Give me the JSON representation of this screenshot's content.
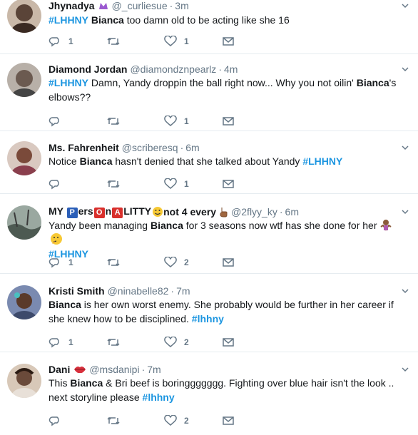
{
  "tweets": [
    {
      "name": "Jhynadya",
      "handle": "@_curliesue",
      "sep": "·",
      "time": "3m",
      "pre_text": "",
      "hashtag_a": "#LHHNY",
      "bold_a": "Bianca",
      "text_a": " too damn old to be acting like she 16",
      "replies": "1",
      "retweets": "",
      "likes": "1",
      "avatar_color": "#5a4438"
    },
    {
      "name": "Diamond Jordan",
      "handle": "@diamondznpearlz",
      "sep": "·",
      "time": "4m",
      "hashtag_a": "#LHHNY",
      "text_a": " Damn, Yandy droppin the ball right now... Why you not oilin' ",
      "bold_a": "Bianca",
      "text_b": "'s",
      "text_c": "elbows??",
      "replies": "",
      "retweets": "",
      "likes": "1",
      "avatar_color": "#6b5a50"
    },
    {
      "name": "Ms. Fahrenheit",
      "handle": "@scriberesq",
      "sep": "·",
      "time": "6m",
      "text_a": "Notice ",
      "bold_a": "Bianca",
      "text_b": " hasn't denied that she talked about Yandy ",
      "hashtag_a": "#LHHNY",
      "replies": "",
      "retweets": "",
      "likes": "1",
      "avatar_color": "#8a3f4d"
    },
    {
      "name_pre": "MY ",
      "name_b1": "P",
      "name_m1": "ers",
      "name_b2": "O",
      "name_m2": "n",
      "name_b3": "A",
      "name_m3": "LITTY",
      "name_post": " not 4 every",
      "handle": "@2flyy_ky",
      "sep": "·",
      "time": "6m",
      "text_a": "Yandy been managing ",
      "bold_a": "Bianca",
      "text_b": " for 3 seasons now wtf has she done for her ",
      "hashtag_a": "#LHHNY",
      "replies": "1",
      "retweets": "",
      "likes": "2",
      "avatar_color": "#4d5a52"
    },
    {
      "name": "Kristi Smith",
      "handle": "@ninabelle82",
      "sep": "·",
      "time": "7m",
      "bold_a": "Bianca",
      "text_a": " is her own worst enemy. She probably would be further in her career if",
      "text_b": "she knew how to be disciplined. ",
      "hashtag_a": "#lhhny",
      "replies": "1",
      "retweets": "",
      "likes": "2",
      "avatar_color": "#3d4a6b"
    },
    {
      "name": "Dani",
      "handle": "@msdanipi",
      "sep": "·",
      "time": "7m",
      "text_a": "This ",
      "bold_a": "Bianca",
      "text_b": " & Bri beef is boringgggggg. Fighting over blue hair isn't the look ..",
      "text_c": "next storyline please ",
      "hashtag_a": "#lhhny",
      "replies": "",
      "retweets": "",
      "likes": "2",
      "avatar_color": "#6a4a3a"
    }
  ],
  "colors": {
    "hashtag": "#1b95e0",
    "muted": "#657786",
    "text": "#14171a",
    "divider": "#e6ecf0"
  },
  "icons": [
    "reply-icon",
    "retweet-icon",
    "like-icon",
    "message-icon",
    "caret-down-icon"
  ]
}
